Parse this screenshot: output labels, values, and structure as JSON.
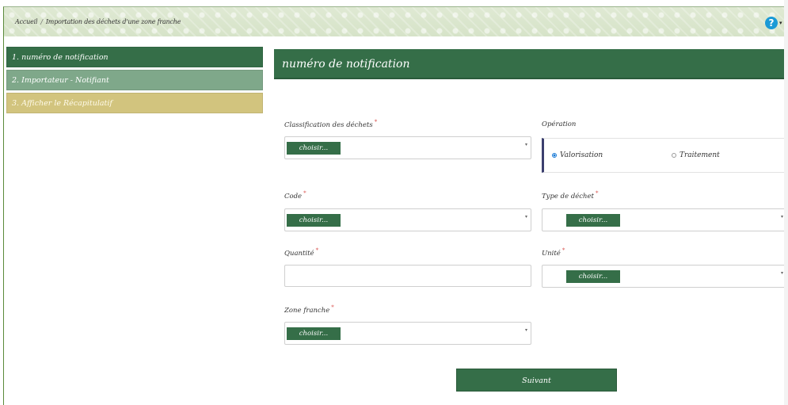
{
  "breadcrumb": {
    "home": "Accueil",
    "separator": "/",
    "current": "Importation des déchets d'une zone franche"
  },
  "help": {
    "icon": "question-circle-icon",
    "glyph": "?",
    "caret": "▾"
  },
  "steps": [
    {
      "label": "1. numéro de notification",
      "state": "active"
    },
    {
      "label": "2. Importateur - Notifiant",
      "state": "pending"
    },
    {
      "label": "3. Afficher le Récapitulatif",
      "state": "pending"
    }
  ],
  "panel": {
    "title": "numéro de notification"
  },
  "form": {
    "required_mark": "*",
    "classification": {
      "label": "Classification des déchets",
      "value": "choisir..."
    },
    "operation": {
      "label": "Opération",
      "options": [
        {
          "label": "Valorisation",
          "selected": true
        },
        {
          "label": "Traitement",
          "selected": false
        }
      ]
    },
    "code": {
      "label": "Code",
      "value": "choisir..."
    },
    "type_dechet": {
      "label": "Type de déchet",
      "value": "choisir..."
    },
    "quantite": {
      "label": "Quantité",
      "value": ""
    },
    "unite": {
      "label": "Unité",
      "value": "choisir..."
    },
    "zone_franche": {
      "label": "Zone franche",
      "value": "choisir..."
    },
    "caret": "▾"
  },
  "buttons": {
    "next": "Suivant"
  },
  "colors": {
    "primary": "#356e48",
    "step_pending": "#7fa88a",
    "step_summary": "#d2c47e",
    "help": "#1a9ad6"
  }
}
